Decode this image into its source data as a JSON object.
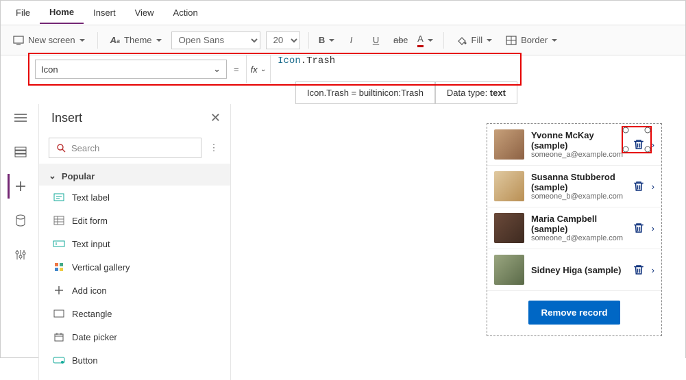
{
  "menu": {
    "file": "File",
    "home": "Home",
    "insert": "Insert",
    "view": "View",
    "action": "Action"
  },
  "toolbar": {
    "newscreen": "New screen",
    "theme": "Theme",
    "fontname": "Open Sans",
    "fontsize": "20",
    "fill": "Fill",
    "border": "Border"
  },
  "formula": {
    "property": "Icon",
    "eq": "=",
    "fx": "fx",
    "ns": "Icon",
    "dot": ".",
    "val": "Trash",
    "result_left": "Icon.Trash  =  builtinicon:Trash",
    "result_right_label": "Data type: ",
    "result_right_value": "text"
  },
  "panel": {
    "title": "Insert",
    "search_placeholder": "Search",
    "section": "Popular",
    "items": [
      "Text label",
      "Edit form",
      "Text input",
      "Vertical gallery",
      "Add icon",
      "Rectangle",
      "Date picker",
      "Button"
    ]
  },
  "gallery": {
    "rows": [
      {
        "name": "Yvonne McKay (sample)",
        "email": "someone_a@example.com"
      },
      {
        "name": "Susanna Stubberod (sample)",
        "email": "someone_b@example.com"
      },
      {
        "name": "Maria Campbell (sample)",
        "email": "someone_d@example.com"
      },
      {
        "name": "Sidney Higa (sample)",
        "email": ""
      }
    ],
    "remove_label": "Remove record"
  }
}
